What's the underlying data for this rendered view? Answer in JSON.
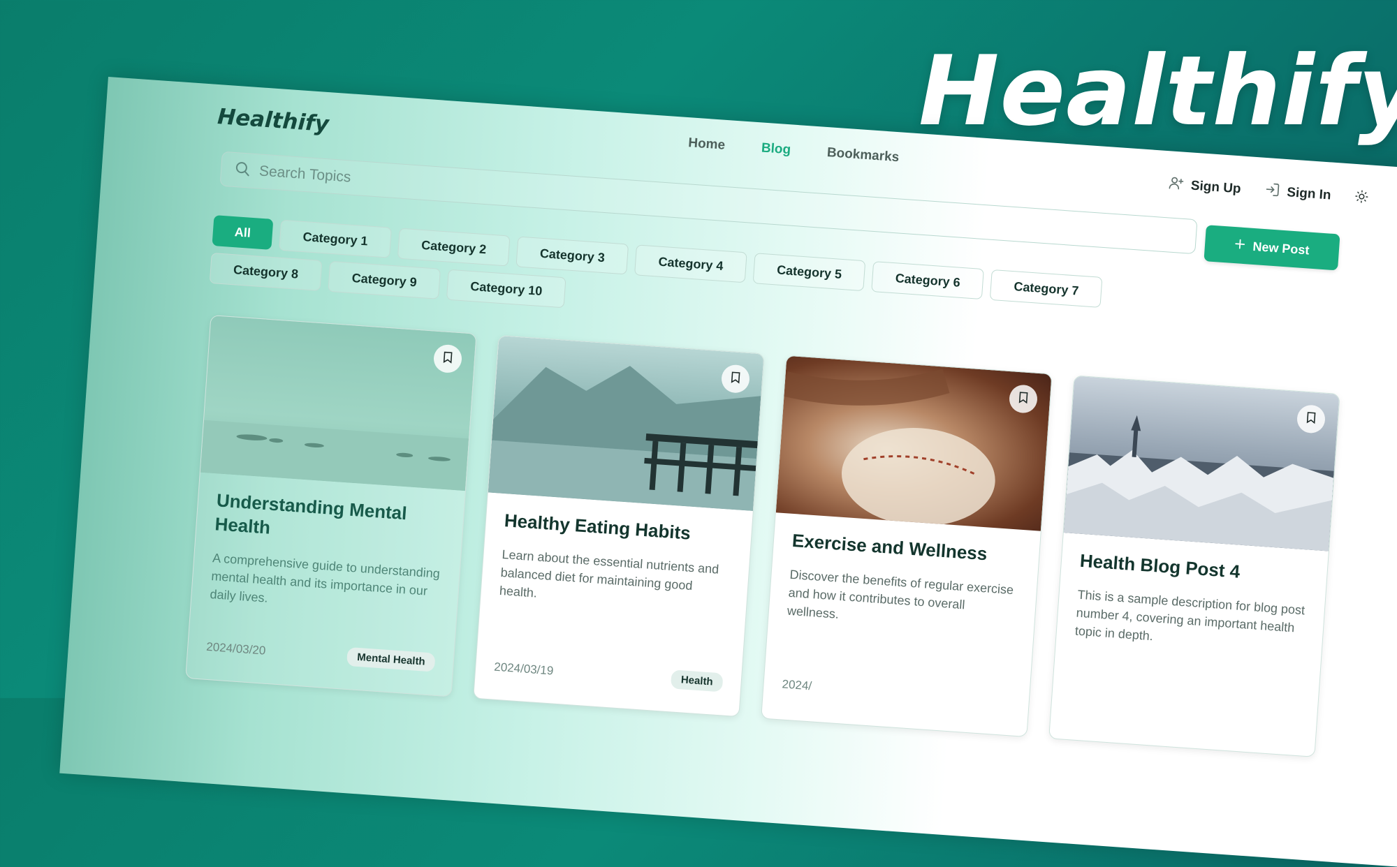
{
  "hero": {
    "title": "Healthify"
  },
  "app": {
    "logo": "Healthify"
  },
  "nav": {
    "items": [
      {
        "label": "Home",
        "active": false
      },
      {
        "label": "Blog",
        "active": true
      },
      {
        "label": "Bookmarks",
        "active": false
      }
    ]
  },
  "auth": {
    "sign_up": "Sign Up",
    "sign_in": "Sign In",
    "theme_icon": "sun-icon"
  },
  "search": {
    "placeholder": "Search Topics"
  },
  "new_post": {
    "label": "New Post"
  },
  "categories": [
    "All",
    "Category 1",
    "Category 2",
    "Category 3",
    "Category 4",
    "Category 5",
    "Category 6",
    "Category 7",
    "Category 8",
    "Category 9",
    "Category 10"
  ],
  "active_category": "All",
  "colors": {
    "accent": "#1aad80",
    "brand_dark": "#14493d",
    "background": "#0a7d6b"
  },
  "posts": [
    {
      "title": "Understanding Mental Health",
      "description": "A comprehensive guide to understanding mental health and its importance in our daily lives.",
      "date": "2024/03/20",
      "tag": "Mental Health"
    },
    {
      "title": "Healthy Eating Habits",
      "description": "Learn about the essential nutrients and balanced diet for maintaining good health.",
      "date": "2024/03/19",
      "tag": "Health"
    },
    {
      "title": "Exercise and Wellness",
      "description": "Discover the benefits of regular exercise and how it contributes to overall wellness.",
      "date": "2024/",
      "tag": ""
    },
    {
      "title": "Health Blog Post 4",
      "description": "This is a sample description for blog post number 4, covering an important health topic in depth.",
      "date": "",
      "tag": ""
    }
  ]
}
